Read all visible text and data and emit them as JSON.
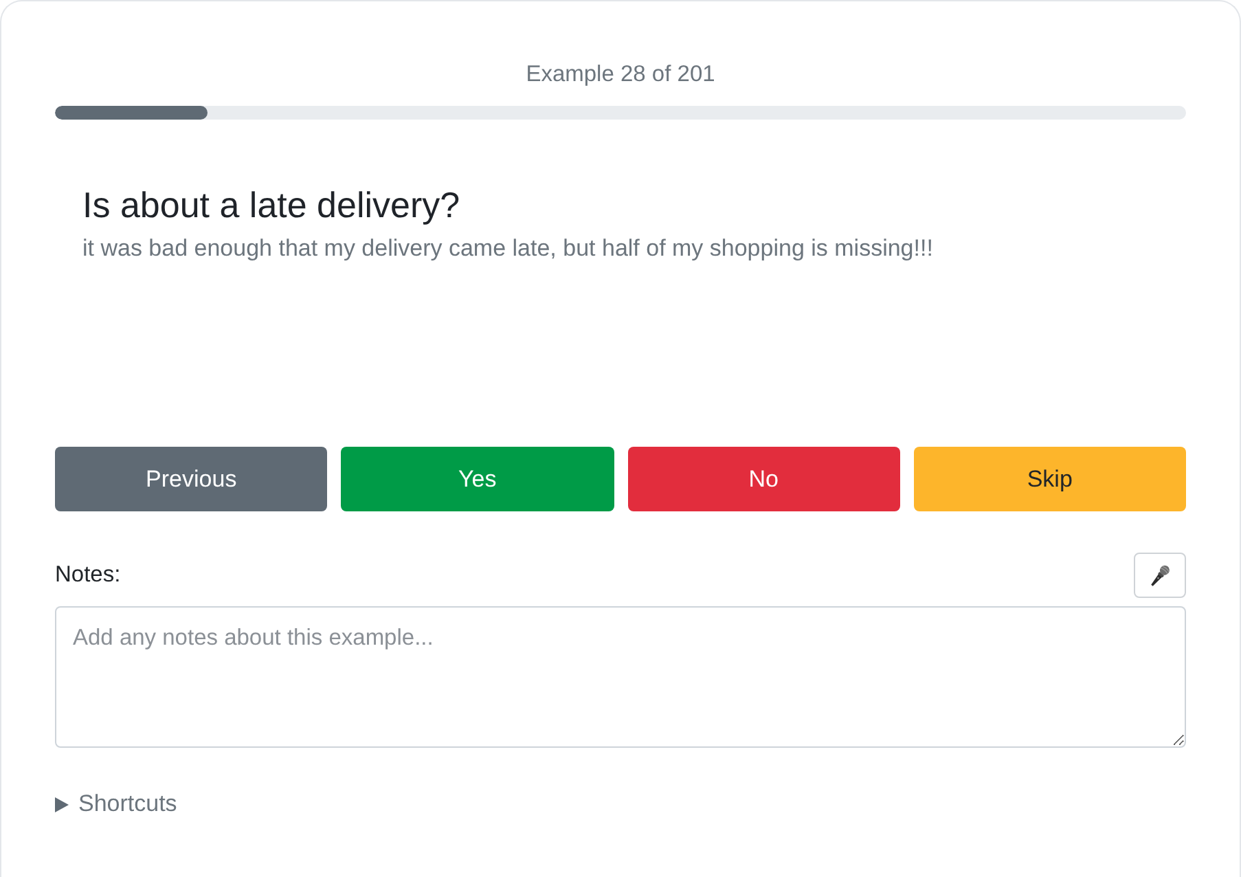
{
  "progress": {
    "label": "Example 28 of 201",
    "level": 0.135
  },
  "question": {
    "title": "Is about a late delivery?",
    "text": "it was bad enough that my delivery came late, but half of my shopping is missing!!!"
  },
  "buttons": [
    {
      "label": "Previous",
      "kind": "previous"
    },
    {
      "label": "Yes",
      "kind": "yes"
    },
    {
      "label": "No",
      "kind": "no"
    },
    {
      "label": "Skip",
      "kind": "skip"
    }
  ],
  "notes": {
    "label": "Notes:",
    "placeholder": "Add any notes about this example..."
  },
  "shortcuts": {
    "label": "Shortcuts",
    "expanded": false
  }
}
